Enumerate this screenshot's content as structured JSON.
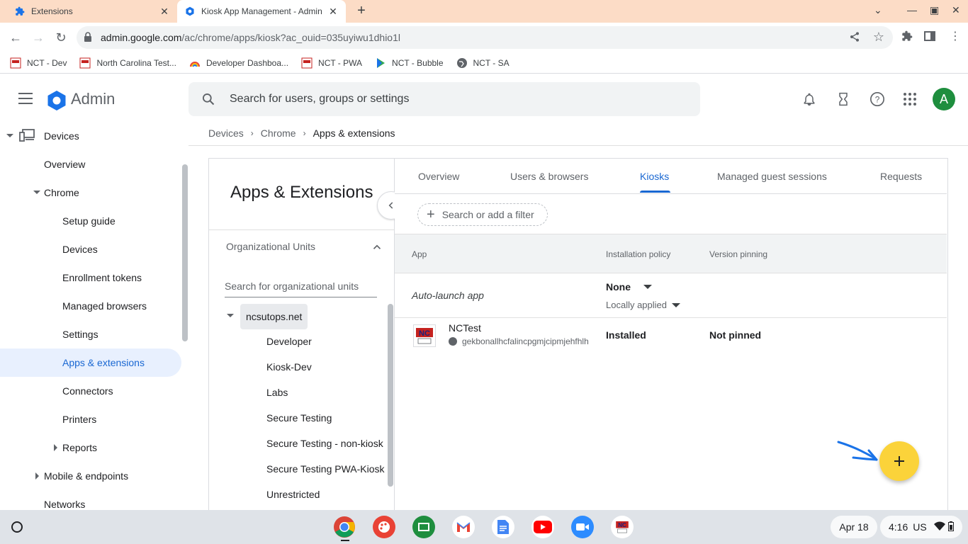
{
  "browser": {
    "tabs": [
      {
        "title": "Extensions"
      },
      {
        "title": "Kiosk App Management - Admin"
      }
    ],
    "url_host": "admin.google.com",
    "url_path": "/ac/chrome/apps/kiosk?ac_ouid=035uyiwu1dhio1l",
    "bookmarks": [
      {
        "label": "NCT - Dev"
      },
      {
        "label": "North Carolina Test..."
      },
      {
        "label": "Developer Dashboa..."
      },
      {
        "label": "NCT - PWA"
      },
      {
        "label": "NCT - Bubble"
      },
      {
        "label": "NCT - SA"
      }
    ]
  },
  "header": {
    "app_name": "Admin",
    "search_placeholder": "Search for users, groups or settings",
    "avatar_letter": "A"
  },
  "nav": {
    "devices": "Devices",
    "overview": "Overview",
    "chrome": "Chrome",
    "setup_guide": "Setup guide",
    "chrome_devices": "Devices",
    "enrollment_tokens": "Enrollment tokens",
    "managed_browsers": "Managed browsers",
    "settings": "Settings",
    "apps_extensions": "Apps & extensions",
    "connectors": "Connectors",
    "printers": "Printers",
    "reports": "Reports",
    "mobile_endpoints": "Mobile & endpoints",
    "networks": "Networks"
  },
  "breadcrumb": {
    "level1": "Devices",
    "level2": "Chrome",
    "current": "Apps & extensions"
  },
  "left_panel": {
    "title": "Apps & Extensions",
    "ou_header": "Organizational Units",
    "ou_search_placeholder": "Search for organizational units",
    "root": "ncsutops.net",
    "children": [
      "Developer",
      "Kiosk-Dev",
      "Labs",
      "Secure Testing",
      "Secure Testing - non-kiosk",
      "Secure Testing PWA-Kiosk",
      "Unrestricted"
    ]
  },
  "tabs": {
    "overview": "Overview",
    "users_browsers": "Users & browsers",
    "kiosks": "Kiosks",
    "managed_guest": "Managed guest sessions",
    "requests": "Requests"
  },
  "filter": {
    "label": "Search or add a filter"
  },
  "table": {
    "col_app": "App",
    "col_policy": "Installation policy",
    "col_version": "Version pinning",
    "autolaunch": {
      "label": "Auto-launch app",
      "policy": "None",
      "sub": "Locally applied"
    },
    "app": {
      "name": "NCTest",
      "id": "gekbonallhcfalincpgmjcipmjehfhlh",
      "policy": "Installed",
      "version": "Not pinned"
    }
  },
  "shelf": {
    "date": "Apr 18",
    "time": "4:16",
    "locale": "US"
  },
  "colors": {
    "accent": "#1967d2",
    "fab": "#fbd33a",
    "tabstrip": "#fcdcc6",
    "selected_nav_bg": "#e8f0fe"
  }
}
